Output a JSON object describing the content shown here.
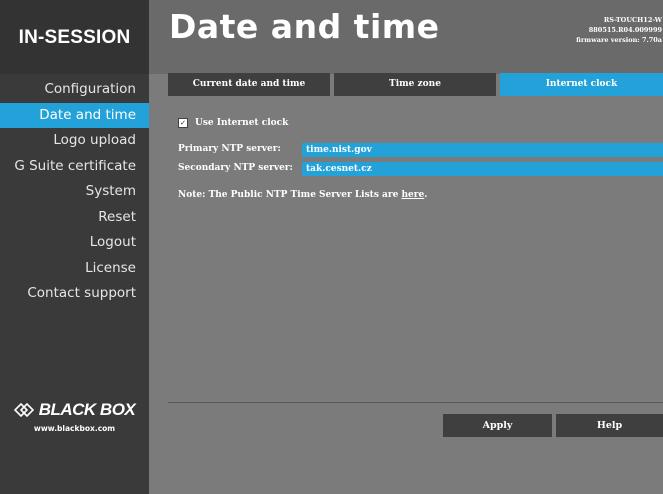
{
  "brand": {
    "name": "IN-SESSION"
  },
  "header": {
    "title": "Date and time",
    "device_model": "RS-TOUCH12-W",
    "device_serial": "880515.R04.009999",
    "firmware": "firmware version: 7.70a"
  },
  "sidebar": {
    "items": [
      {
        "label": "Configuration",
        "active": false
      },
      {
        "label": "Date and time",
        "active": true
      },
      {
        "label": "Logo upload",
        "active": false
      },
      {
        "label": "G Suite certificate",
        "active": false
      },
      {
        "label": "System",
        "active": false
      },
      {
        "label": "Reset",
        "active": false
      },
      {
        "label": "Logout",
        "active": false
      },
      {
        "label": "License",
        "active": false
      },
      {
        "label": "Contact support",
        "active": false
      }
    ]
  },
  "logo": {
    "text": "BLACK BOX",
    "url": "www.blackbox.com"
  },
  "tabs": [
    {
      "label": "Current date and time",
      "active": false
    },
    {
      "label": "Time zone",
      "active": false
    },
    {
      "label": "Internet clock",
      "active": true
    }
  ],
  "internet_clock": {
    "use_label": "Use Internet clock",
    "checked": true,
    "primary_label": "Primary NTP server:",
    "primary_value": "time.nist.gov",
    "secondary_label": "Secondary NTP server:",
    "secondary_value": "tak.cesnet.cz",
    "note_prefix": "Note: The Public NTP Time Server Lists are ",
    "note_link": "here",
    "note_suffix": "."
  },
  "buttons": {
    "apply": "Apply",
    "help": "Help"
  },
  "colors": {
    "accent": "#22a2d9",
    "sidebar": "#3a3a3a",
    "content": "#7b7b7b",
    "tab": "#3f3f3f"
  }
}
